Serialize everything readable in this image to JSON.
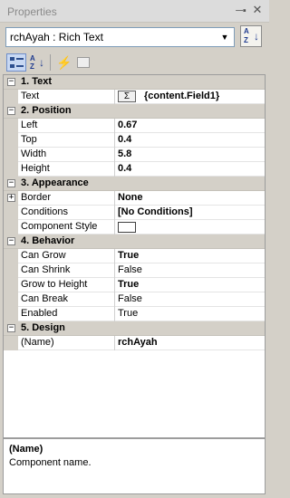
{
  "window": {
    "title": "Properties",
    "pin_glyph": "–■",
    "close_glyph": "✕"
  },
  "object_selector": {
    "value": "rchAyah : Rich Text"
  },
  "sort_button": {
    "az": "A\nZ"
  },
  "toolbar": {
    "alpha_label": "A\nZ"
  },
  "grid": {
    "categories": [
      {
        "label": "1. Text",
        "expanded_glyph": "−"
      },
      {
        "label": "2. Position",
        "expanded_glyph": "−"
      },
      {
        "label": "3. Appearance",
        "expanded_glyph": "−"
      },
      {
        "label": "4. Behavior",
        "expanded_glyph": "−"
      },
      {
        "label": "5. Design",
        "expanded_glyph": "−"
      }
    ],
    "text": {
      "name": "Text",
      "sigma": "Σ",
      "value": "{content.Field1}"
    },
    "left": {
      "name": "Left",
      "value": "0.67"
    },
    "top": {
      "name": "Top",
      "value": "0.4"
    },
    "width": {
      "name": "Width",
      "value": "5.8"
    },
    "height": {
      "name": "Height",
      "value": "0.4"
    },
    "border": {
      "name": "Border",
      "value": "None",
      "expand_glyph": "+"
    },
    "conditions": {
      "name": "Conditions",
      "value": "[No Conditions]"
    },
    "component_style": {
      "name": "Component Style",
      "value": ""
    },
    "can_grow": {
      "name": "Can Grow",
      "value": "True"
    },
    "can_shrink": {
      "name": "Can Shrink",
      "value": "False"
    },
    "grow_to_height": {
      "name": "Grow to Height",
      "value": "True"
    },
    "can_break": {
      "name": "Can Break",
      "value": "False"
    },
    "enabled": {
      "name": "Enabled",
      "value": "True"
    },
    "name": {
      "name": "(Name)",
      "value": "rchAyah"
    }
  },
  "description": {
    "title": "(Name)",
    "text": "Component name."
  }
}
